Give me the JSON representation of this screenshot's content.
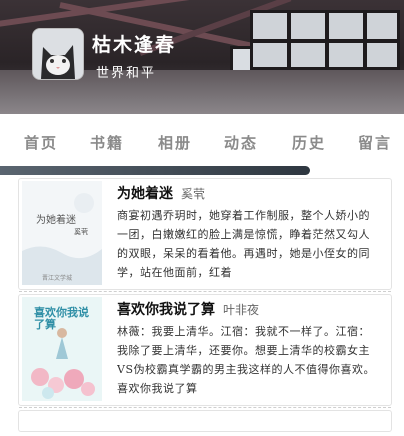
{
  "header": {
    "title": "枯木逢春",
    "subtitle": "世界和平"
  },
  "nav": {
    "items": [
      {
        "label": "首页"
      },
      {
        "label": "书籍"
      },
      {
        "label": "相册"
      },
      {
        "label": "动态"
      },
      {
        "label": "历史"
      },
      {
        "label": "留言"
      }
    ]
  },
  "books": [
    {
      "title": "为她着迷",
      "author": "奚茕",
      "cover_title": "为她着迷",
      "cover_author": "奚茕",
      "cover_bottom": "晋江文学城",
      "description": "商宴初遇乔玥时，她穿着工作制服，整个人娇小的一团，白嫩嫩红的脸上满是惊慌，睁着茫然又勾人的双眼，呆呆的看着他。再遇时，她是小侄女的同学，站在他面前，红着"
    },
    {
      "title": "喜欢你我说了算",
      "author": "叶非夜",
      "cover_title": "喜欢你我说了算",
      "description": "林薇：我要上清华。江宿：我就不一样了。江宿：我除了要上清华，还要你。想要上清华的校霸女主VS伪校霸真学霸的男主我这样的人不值得你喜欢。喜欢你我说了算"
    }
  ]
}
